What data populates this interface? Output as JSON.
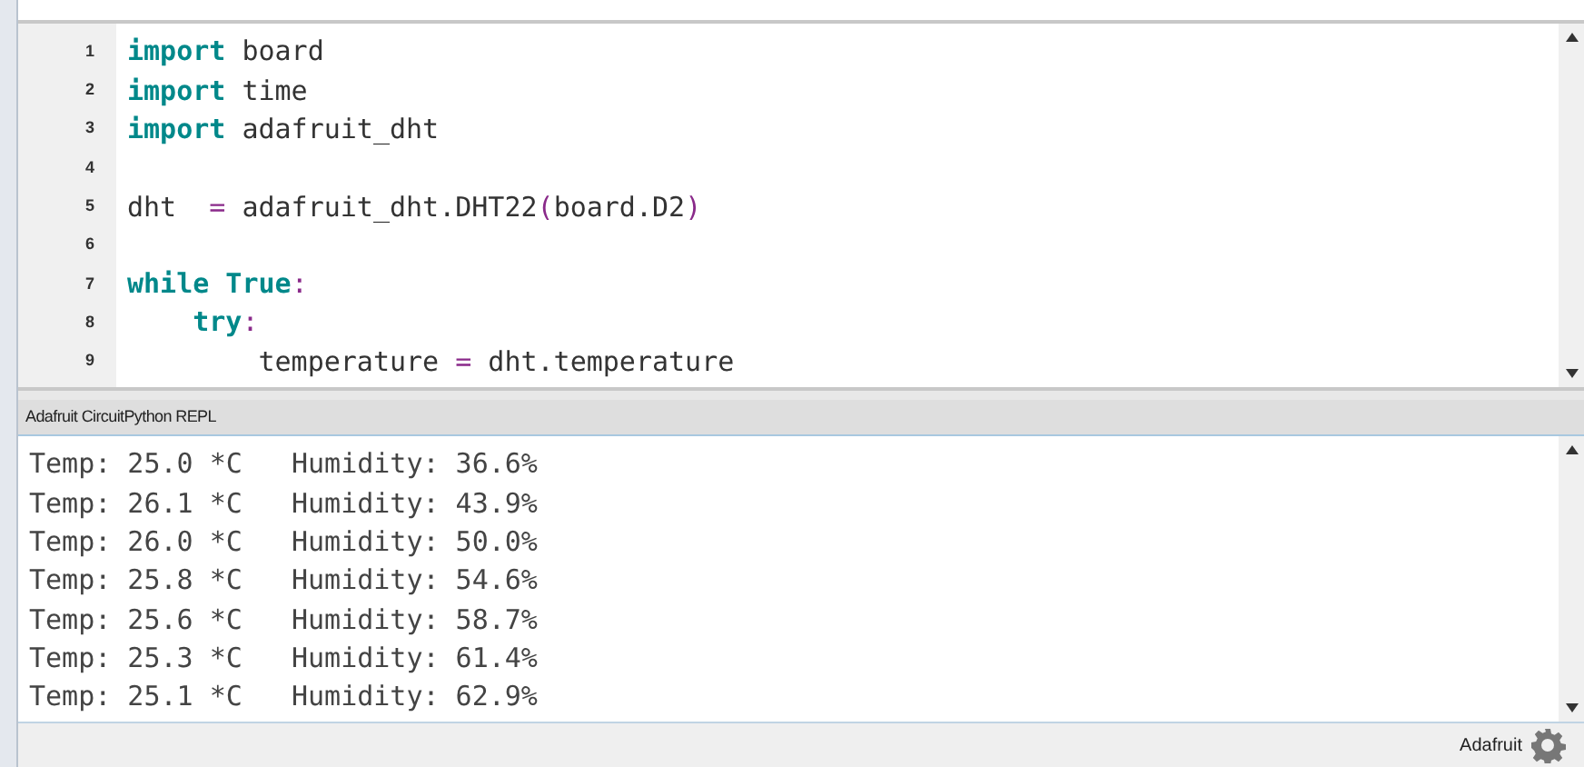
{
  "editor": {
    "lines": [
      {
        "number": "1",
        "tokens": [
          {
            "kind": "keyword",
            "text": "import"
          },
          {
            "kind": "text",
            "text": " board"
          }
        ]
      },
      {
        "number": "2",
        "tokens": [
          {
            "kind": "keyword",
            "text": "import"
          },
          {
            "kind": "text",
            "text": " time"
          }
        ]
      },
      {
        "number": "3",
        "tokens": [
          {
            "kind": "keyword",
            "text": "import"
          },
          {
            "kind": "text",
            "text": " adafruit_dht"
          }
        ]
      },
      {
        "number": "4"
      },
      {
        "number": "5",
        "tokens": [
          {
            "kind": "text",
            "text": "dht  "
          },
          {
            "kind": "punct",
            "text": "="
          },
          {
            "kind": "text",
            "text": " adafruit_dht.DHT22"
          },
          {
            "kind": "punct",
            "text": "("
          },
          {
            "kind": "text",
            "text": "board.D2"
          },
          {
            "kind": "punct",
            "text": ")"
          }
        ]
      },
      {
        "number": "6"
      },
      {
        "number": "7",
        "tokens": [
          {
            "kind": "keyword",
            "text": "while True"
          },
          {
            "kind": "punct",
            "text": ":"
          }
        ]
      },
      {
        "number": "8",
        "tokens": [
          {
            "kind": "keyword",
            "text": "    try"
          },
          {
            "kind": "punct",
            "text": ":"
          }
        ]
      },
      {
        "number": "9",
        "tokens": [
          {
            "kind": "text",
            "text": "        temperature "
          },
          {
            "kind": "punct",
            "text": "="
          },
          {
            "kind": "text",
            "text": " dht.temperature"
          }
        ]
      }
    ]
  },
  "repl": {
    "title": "Adafruit CircuitPython REPL",
    "lines": [
      "Temp: 25.0 *C   Humidity: 36.6%",
      "Temp: 26.1 *C   Humidity: 43.9%",
      "Temp: 26.0 *C   Humidity: 50.0%",
      "Temp: 25.8 *C   Humidity: 54.6%",
      "Temp: 25.6 *C   Humidity: 58.7%",
      "Temp: 25.3 *C   Humidity: 61.4%",
      "Temp: 25.1 *C   Humidity: 62.9%"
    ]
  },
  "status_bar": {
    "mode": "Adafruit"
  }
}
